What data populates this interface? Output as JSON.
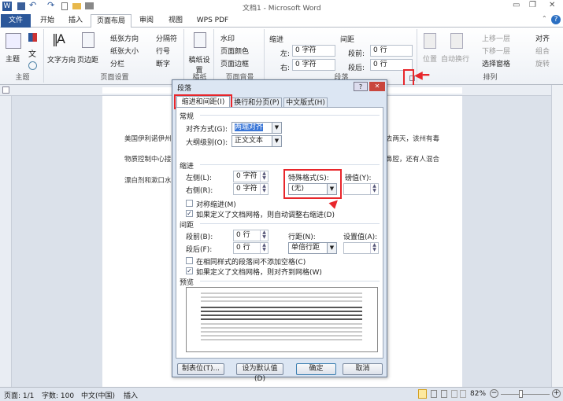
{
  "window": {
    "title": "文档1 - Microsoft Word"
  },
  "tabs": [
    {
      "label": "文件"
    },
    {
      "label": "开始"
    },
    {
      "label": "插入"
    },
    {
      "label": "页面布局"
    },
    {
      "label": "审阅"
    },
    {
      "label": "视图"
    },
    {
      "label": "WPS PDF"
    }
  ],
  "ribbon": {
    "theme": {
      "button": "主题",
      "group": "主题"
    },
    "page_setup": {
      "text_dir": "文字方向",
      "margins": "页边距",
      "orientation": "纸张方向",
      "size": "纸张大小",
      "columns": "分栏",
      "breaks": "分隔符",
      "line_numbers": "行号",
      "hyphenation": "断字",
      "group": "页面设置"
    },
    "manuscript": {
      "button": "稿纸设置",
      "group": "稿纸"
    },
    "background": {
      "watermark": "水印",
      "page_color": "页面颜色",
      "page_border": "页面边框",
      "group": "页面背景"
    },
    "paragraph": {
      "indent": "缩进",
      "left_label": "左:",
      "left_value": "0 字符",
      "right_label": "右:",
      "right_value": "0 字符",
      "spacing": "间距",
      "before_label": "段前:",
      "before_value": "0 行",
      "after_label": "段后:",
      "after_value": "0 行",
      "group": "段落"
    },
    "arrange": {
      "position": "位置",
      "wrap": "自动换行",
      "forward": "上移一层",
      "backward": "下移一层",
      "selection_pane": "选择窗格",
      "align": "对齐",
      "group_btn": "组合",
      "rotate": "旋转",
      "group": "排列"
    }
  },
  "document": {
    "lines": [
      {
        "left": "美国伊利诺伊州",
        "right": "去两天，该州有毒"
      },
      {
        "left": "物质控制中心接",
        "right": "鼻腔，还有人混合"
      },
      {
        "left": "漂白剂和漱口水",
        "right": ""
      }
    ]
  },
  "dialog": {
    "title": "段落",
    "tabs": [
      "缩进和间距(I)",
      "换行和分页(P)",
      "中文版式(H)"
    ],
    "general": {
      "heading": "常规",
      "align_label": "对齐方式(G):",
      "align_value": "两端对齐",
      "outline_label": "大纲级别(O):",
      "outline_value": "正文文本"
    },
    "indent": {
      "heading": "缩进",
      "left_label": "左侧(L):",
      "left_value": "0 字符",
      "right_label": "右侧(R):",
      "right_value": "0 字符",
      "special_label": "特殊格式(S):",
      "special_value": "(无)",
      "by_label": "磅值(Y):",
      "by_value": "",
      "mirror_label": "对称缩进(M)",
      "mirror_checked": false,
      "auto_adjust_label": "如果定义了文档网格，则自动调整右缩进(D)",
      "auto_adjust_checked": true
    },
    "spacing": {
      "heading": "间距",
      "before_label": "段前(B):",
      "before_value": "0 行",
      "after_label": "段后(F):",
      "after_value": "0 行",
      "line_label": "行距(N):",
      "line_value": "单倍行距",
      "at_label": "设置值(A):",
      "at_value": "",
      "no_space_label": "在相同样式的段落间不添加空格(C)",
      "no_space_checked": false,
      "snap_label": "如果定义了文档网格，则对齐到网格(W)",
      "snap_checked": true
    },
    "preview": {
      "heading": "预览"
    },
    "buttons": {
      "tabs": "制表位(T)...",
      "default": "设为默认值(D)",
      "ok": "确定",
      "cancel": "取消"
    }
  },
  "status": {
    "page": "页面: 1/1",
    "words": "字数: 100",
    "lang": "中文(中国)",
    "mode": "插入",
    "zoom": "82%"
  },
  "colors": {
    "accent": "#2b579a",
    "highlight": "#e8262b"
  }
}
